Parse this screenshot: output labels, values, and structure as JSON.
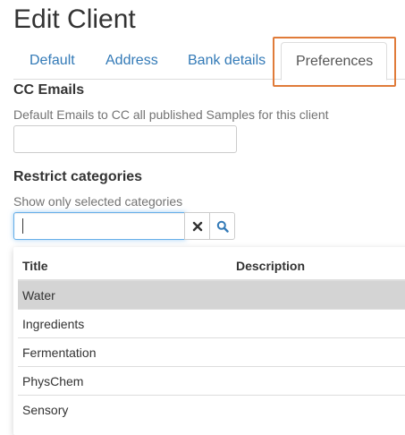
{
  "page": {
    "title": "Edit Client"
  },
  "tabs": [
    {
      "label": "Default"
    },
    {
      "label": "Address"
    },
    {
      "label": "Bank details"
    },
    {
      "label": "Preferences",
      "active": true
    }
  ],
  "cc_emails": {
    "label": "CC Emails",
    "help": "Default Emails to CC all published Samples for this client",
    "value": ""
  },
  "restrict_categories": {
    "label": "Restrict categories",
    "help": "Show only selected categories",
    "search_value": ""
  },
  "results": {
    "columns": [
      "Title",
      "Description"
    ],
    "rows": [
      {
        "title": "Water",
        "description": "",
        "selected": true
      },
      {
        "title": "Ingredients",
        "description": ""
      },
      {
        "title": "Fermentation",
        "description": ""
      },
      {
        "title": "PhysChem",
        "description": ""
      },
      {
        "title": "Sensory",
        "description": ""
      }
    ]
  },
  "colors": {
    "link": "#337ab7",
    "highlight": "#e07b39",
    "selected_row": "#d4d4d4"
  },
  "icons": {
    "clear": "close-icon",
    "search": "search-icon"
  }
}
